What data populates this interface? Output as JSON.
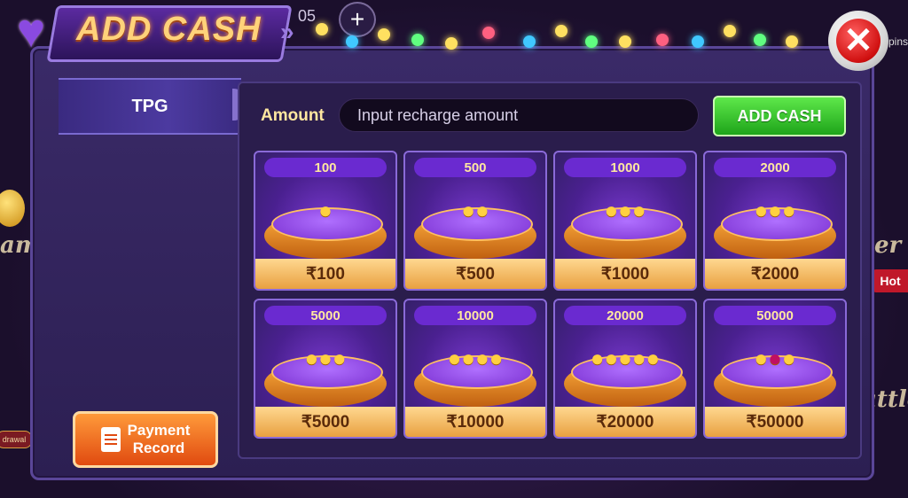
{
  "header": {
    "title": "ADD CASH",
    "balance_fragment": "05",
    "plus_label": "+",
    "close_label": "✕"
  },
  "background": {
    "left_text": "am",
    "right_top_text": "ker",
    "right_bottom_text": "attle",
    "hot_badge": "Hot",
    "withdraw_badge": "drawal",
    "spins_text": "pins"
  },
  "sidebar": {
    "tab_label": "TPG",
    "record_button_label_line1": "Payment",
    "record_button_label_line2": "Record"
  },
  "form": {
    "amount_label": "Amount",
    "amount_placeholder": "Input recharge amount",
    "add_button_label": "ADD CASH"
  },
  "cards": [
    {
      "tag": "100",
      "price": "₹100"
    },
    {
      "tag": "500",
      "price": "₹500"
    },
    {
      "tag": "1000",
      "price": "₹1000"
    },
    {
      "tag": "2000",
      "price": "₹2000"
    },
    {
      "tag": "5000",
      "price": "₹5000"
    },
    {
      "tag": "10000",
      "price": "₹10000"
    },
    {
      "tag": "20000",
      "price": "₹20000"
    },
    {
      "tag": "50000",
      "price": "₹50000"
    }
  ],
  "colors": {
    "accent_gold": "#ffd27a",
    "panel": "#3a2a68",
    "add_button": "#1ea41a",
    "record_button": "#e04a10",
    "close_button": "#d01010"
  }
}
